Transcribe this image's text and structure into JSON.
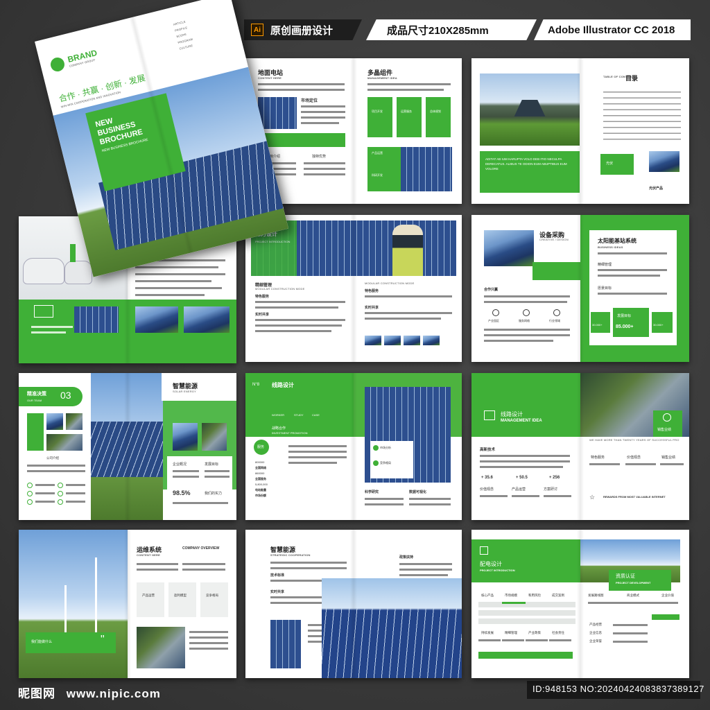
{
  "header": {
    "ai_badge": "Ai",
    "design_label": "原创画册设计",
    "size_label": "成品尺寸210X285mm",
    "software_label": "Adobe Illustrator CC 2018"
  },
  "cover": {
    "brand": "BRAND",
    "brand_sub": "COMPANY GROUP",
    "slogan": "合作 · 共赢 · 创新 · 发展",
    "slogan_en": "WIN-WIN COOPERATION AND INNOVATION",
    "title_line1": "NEW",
    "title_line2": "BUSINESS",
    "title_line3": "BROCHURE",
    "title_sub": "NEW BUSINESS BROCHURE",
    "menu": [
      "ARTICLE",
      "PROFILE",
      "SCOPE",
      "PROGRAM",
      "CULTURE"
    ]
  },
  "pages": {
    "p1_left_title": "地面电站",
    "p1_left_sub": "CONTENT HERE",
    "p1_market": "市场定位",
    "p1_item1": "项目介绍",
    "p1_item2": "独特优势",
    "p1_right_title": "多晶组件",
    "p1_right_sub": "MANAGEMENT IDEA",
    "p1_box1": "项目开发",
    "p1_box2": "运营服务",
    "p1_box3": "总体规划",
    "p1_product": "产品运营",
    "p1_research": "科研开发",
    "p2_toc_en": "TABLE OF CONTENTS",
    "p2_toc": "目录",
    "p2_caption": "ADITAT AB IUM HARUPTA VOLO DEB ITIO NECULPA DERECATUS. ALIBUS TE ODION EUM ABUPTIBUS EUM VOLORE",
    "p2_brand": "光伏产品",
    "p2_green": "光伏",
    "p3_title": "电力设计",
    "p3_sub": "PROJECT INTRODUCTION",
    "p3_mgmt": "精细管理",
    "p3_mod": "MODULAR CONSTRUCTION MODE",
    "p3_service": "特色服务",
    "p3_share": "实时共享",
    "p3_service2": "特色服务",
    "p3_share2": "实时共享",
    "p4_title": "设备采购",
    "p4_sub": "CREATIVE / DESIGN",
    "p4_coop": "合作只赢",
    "p4_ic1": "产业园区",
    "p4_ic2": "服务网络",
    "p4_ic3": "行业领域",
    "p4_right_title": "太阳能基站系统",
    "p4_right_sub": "BUSINESS IDEAS",
    "p4_ops": "精细管理",
    "p4_target": "愿景目标",
    "p4_goal": "发展目标",
    "p4_n1": "30.000+",
    "p4_n2": "85.000+",
    "p4_n3": "30.000+",
    "p5_title": "精准决策",
    "p5_sub": "OUR TEAM",
    "p5_num": "03",
    "p5_corp": "公司介绍",
    "p5_right_title": "智慧能源",
    "p5_right_sub": "SOLAR ENERGY",
    "p5_overview": "企业概况",
    "p5_goal": "发展目标",
    "p5_percent": "98.5%",
    "p5_power": "我们的实力",
    "p5_list": [
      "1",
      "2",
      "3",
      "4",
      "5",
      "6"
    ],
    "p6_no": "N°8",
    "p6_title": "线路设计",
    "p6_nav": [
      "WORKER",
      "STUDY",
      "CASE"
    ],
    "p6_strategy": "战略合作",
    "p6_strategy_en": "INVESTMENT PROMOTION",
    "p6_badge": "服务",
    "p6_stats": [
      "800000",
      "全国网络",
      "860000",
      "全国服务",
      "5,800,000",
      "电站能量",
      "市场份额"
    ],
    "p6_market": "市场分析",
    "p6_advantage": "竞争格局",
    "p6_research": "科学研究",
    "p6_visual": "数据可视化",
    "p7_title": "线路设计",
    "p7_sub": "MANAGEMENT IDEA",
    "p7_tech": "高新技术",
    "p7_n1": "+ 35.6",
    "p7_n2": "+ 50.5",
    "p7_n3": "+ 256",
    "p7_c1": "价值观念",
    "p7_c2": "产品运营",
    "p7_c3": "方案研讨",
    "p7_sales": "销售业绩",
    "p7_f1": "特色服务",
    "p7_f2": "价值观念",
    "p7_f3": "销售业绩",
    "p7_reward": "REWARDS FROM MOST VALUABLE INTERNET",
    "p7_intro": "WE HAVE MORE THAN TWENTY YEARS OF SUCCESSFUL PRO",
    "p8_title": "运维系统",
    "p8_sub": "CONTENT HERE",
    "p8_overview": "COMPANY OVERVIEW",
    "p8_b1": "产品运营",
    "p8_b2": "盈利模型",
    "p8_b3": "竞争格局",
    "p8_quote": "我们能做什么",
    "p9_title": "智慧能源",
    "p9_sub": "STRATEGIC COOPERATION",
    "p9_tech": "技术标准",
    "p9_share": "实时共享",
    "p9_policy": "政策扶持",
    "p10_title": "配电设计",
    "p10_sub": "PROJECT INTRODUCTION",
    "p10_cols": [
      "核心产品",
      "市场规模",
      "和用风险",
      "成交案例"
    ],
    "p10_cols2": [
      "持续发展",
      "精细管理",
      "产业政策",
      "社会责任"
    ],
    "p10_right_title": "资质认证",
    "p10_right_sub": "PROJECT DEVELOPMENT",
    "p10_r1": "发展路线图",
    "p10_r2": "商业模式",
    "p10_r3": "企业价值",
    "p10_r4": "产品经营",
    "p10_r5": "企业信息",
    "p10_r6": "企业荣誉"
  },
  "footer": {
    "site_name": "昵图网",
    "site_url": "www.nipic.com",
    "id_text": "ID:948153 NO:20240424083837389127"
  },
  "colors": {
    "primary_green": "#3fb037",
    "dark_bg": "#3d3d3d"
  }
}
